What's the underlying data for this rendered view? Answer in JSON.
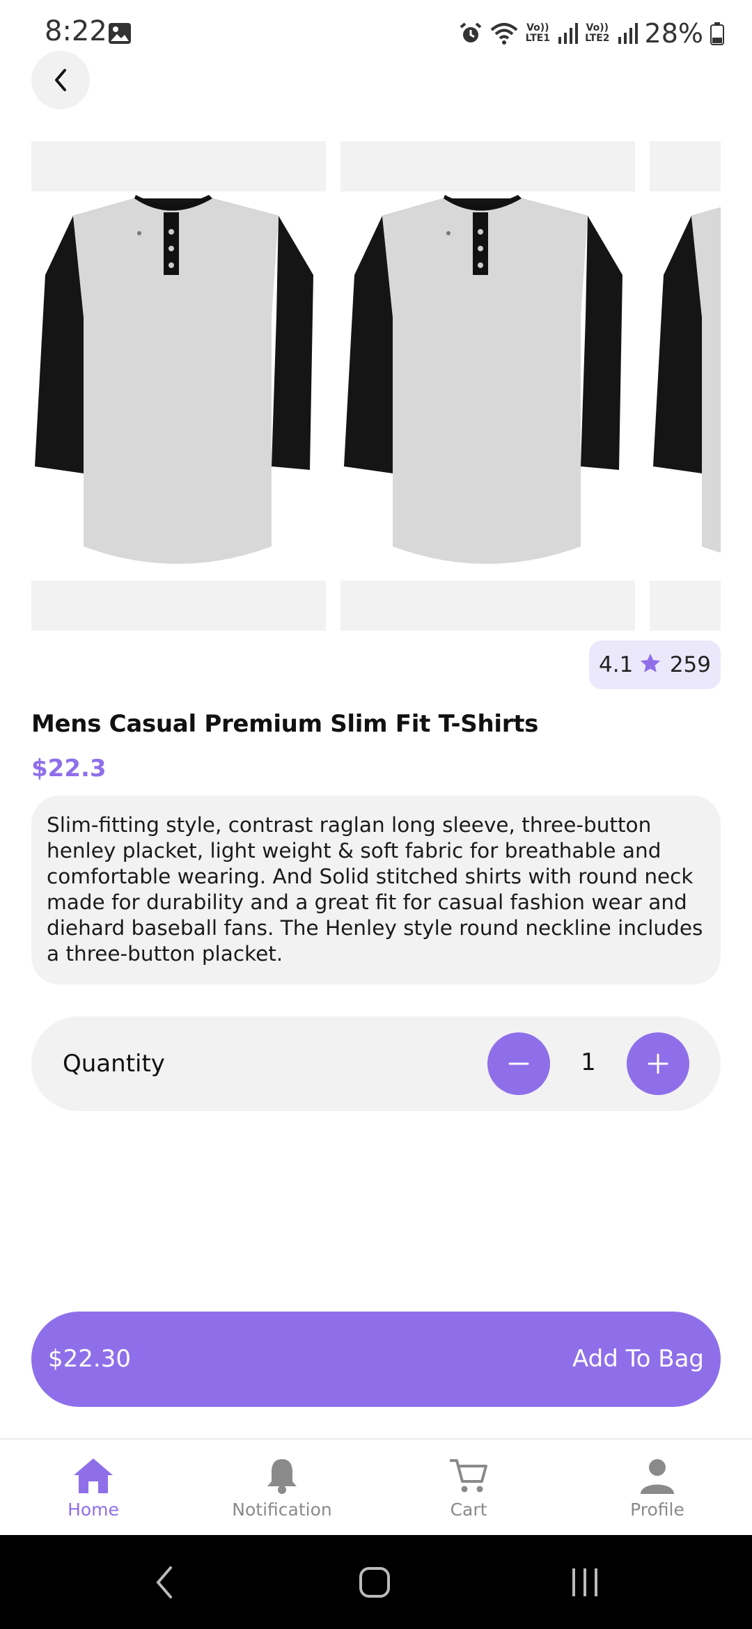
{
  "status_bar": {
    "time": "8:22",
    "battery": "28%",
    "sim1_label_top": "Vo))",
    "sim1_label_bottom": "LTE1",
    "sim2_label_top": "Vo))",
    "sim2_label_bottom": "LTE2",
    "icons": [
      "gallery-icon",
      "alarm-icon",
      "wifi-icon",
      "signal-icon",
      "battery-icon"
    ]
  },
  "product": {
    "images_count": 3,
    "rating": "4.1",
    "reviews": "259",
    "title": "Mens Casual Premium Slim Fit T-Shirts",
    "price": "$22.3",
    "description": "Slim-fitting style, contrast raglan long sleeve, three-button henley placket, light weight & soft fabric for breathable and comfortable wearing. And Solid stitched shirts with round neck made for durability and a great fit for casual fashion wear and diehard baseball fans. The Henley style round neckline includes a three-button placket."
  },
  "quantity": {
    "label": "Quantity",
    "value": "1"
  },
  "cta": {
    "total": "$22.30",
    "label": "Add To Bag"
  },
  "bottom_nav": {
    "items": [
      {
        "label": "Home",
        "icon": "home-icon",
        "active": true
      },
      {
        "label": "Notification",
        "icon": "bell-icon",
        "active": false
      },
      {
        "label": "Cart",
        "icon": "cart-icon",
        "active": false
      },
      {
        "label": "Profile",
        "icon": "person-icon",
        "active": false
      }
    ]
  },
  "colors": {
    "accent": "#8f6fe9",
    "rating_bg": "#ece8fb",
    "panel_bg": "#f2f2f2",
    "shirt_body": "#d6d6d6",
    "shirt_sleeve": "#1a1a1a"
  }
}
